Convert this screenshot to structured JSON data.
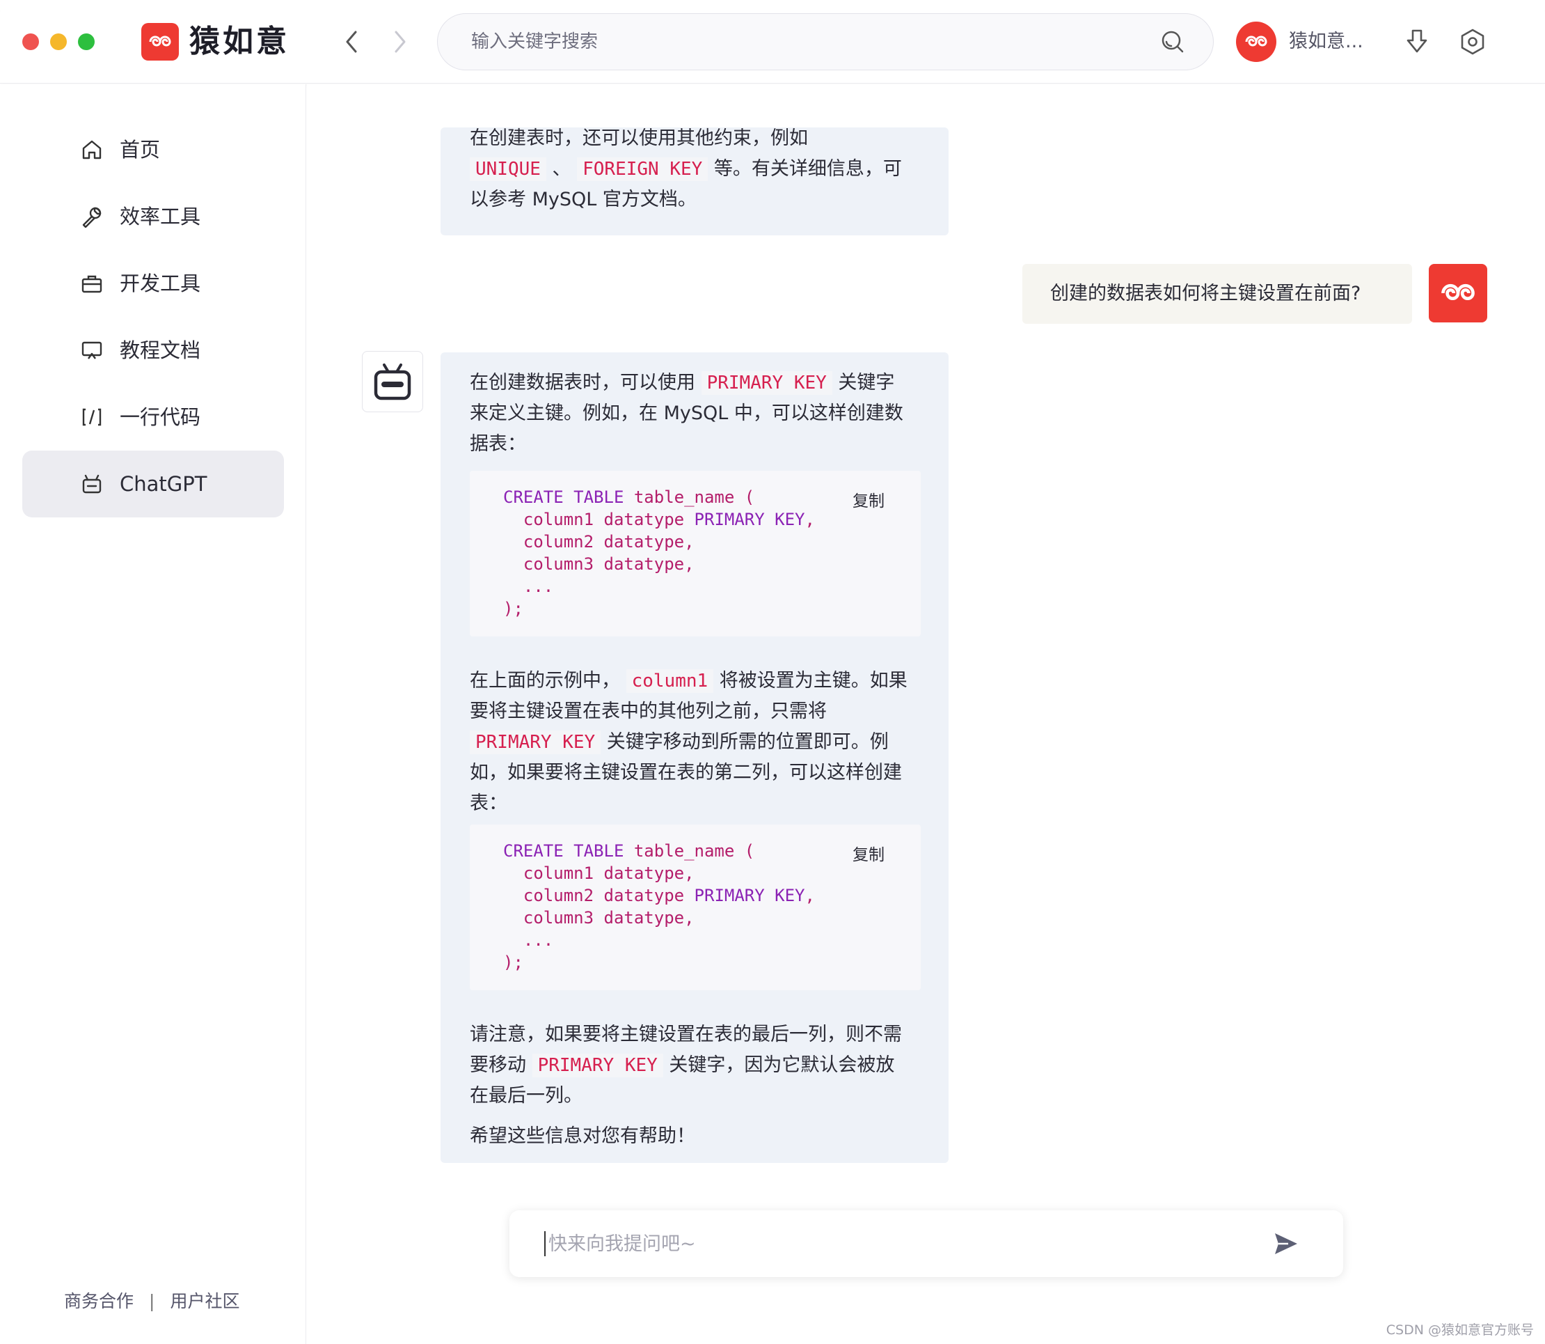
{
  "app": {
    "title": "猿如意"
  },
  "search": {
    "placeholder": "输入关键字搜索"
  },
  "user": {
    "name": "猿如意..."
  },
  "sidebar": {
    "items": [
      {
        "label": "首页",
        "icon": "home-icon"
      },
      {
        "label": "效率工具",
        "icon": "wrench-icon"
      },
      {
        "label": "开发工具",
        "icon": "briefcase-icon"
      },
      {
        "label": "教程文档",
        "icon": "screen-icon"
      },
      {
        "label": "一行代码",
        "icon": "code-icon"
      },
      {
        "label": "ChatGPT",
        "icon": "robot-icon",
        "active": true
      }
    ],
    "footer": {
      "business": "商务合作",
      "separator": "|",
      "community": "用户社区"
    }
  },
  "chat": {
    "prev_answer": {
      "line1": "在创建表时，还可以使用其他约束，例如",
      "code1": "UNIQUE",
      "mid1": "、",
      "code2": "FOREIGN KEY",
      "tail": "等。有关详细信息，可",
      "line3": "以参考 MySQL 官方文档。"
    },
    "question": "创建的数据表如何将主键设置在前面?",
    "answer": {
      "p1_a": "在创建数据表时，可以使用",
      "p1_code": "PRIMARY KEY",
      "p1_b": "关键字",
      "p1_l2": "来定义主键。例如，在 MySQL 中，可以这样创建数",
      "p1_l3": "据表：",
      "code_block_1": "CREATE TABLE table_name (\n  column1 datatype PRIMARY KEY,\n  column2 datatype,\n  column3 datatype,\n  ...\n);",
      "copy_label": "复制",
      "p2_a": "在上面的示例中，",
      "p2_code": "column1",
      "p2_b": "将被设置为主键。如果",
      "p2_l2": "要将主键设置在表中的其他列之前，只需将",
      "p2_code2": "PRIMARY KEY",
      "p2_l3": "关键字移动到所需的位置即可。例",
      "p2_l4": "如，如果要将主键设置在表的第二列，可以这样创建",
      "p2_l5": "表：",
      "code_block_2": "CREATE TABLE table_name (\n  column1 datatype,\n  column2 datatype PRIMARY KEY,\n  column3 datatype,\n  ...\n);",
      "p3_l1": "请注意，如果要将主键设置在表的最后一列，则不需",
      "p3_a": "要移动",
      "p3_code": "PRIMARY KEY",
      "p3_b": "关键字，因为它默认会被放",
      "p3_l3": "在最后一列。",
      "p4": "希望这些信息对您有帮助！"
    },
    "composer": {
      "placeholder": "快来向我提问吧~"
    }
  },
  "watermark": "CSDN @猿如意官方账号",
  "colors": {
    "brand": "#ee3a32",
    "code_inline": "#d6204f",
    "keyword": "#8b22b4",
    "bubble_bg": "#eef2f8"
  }
}
